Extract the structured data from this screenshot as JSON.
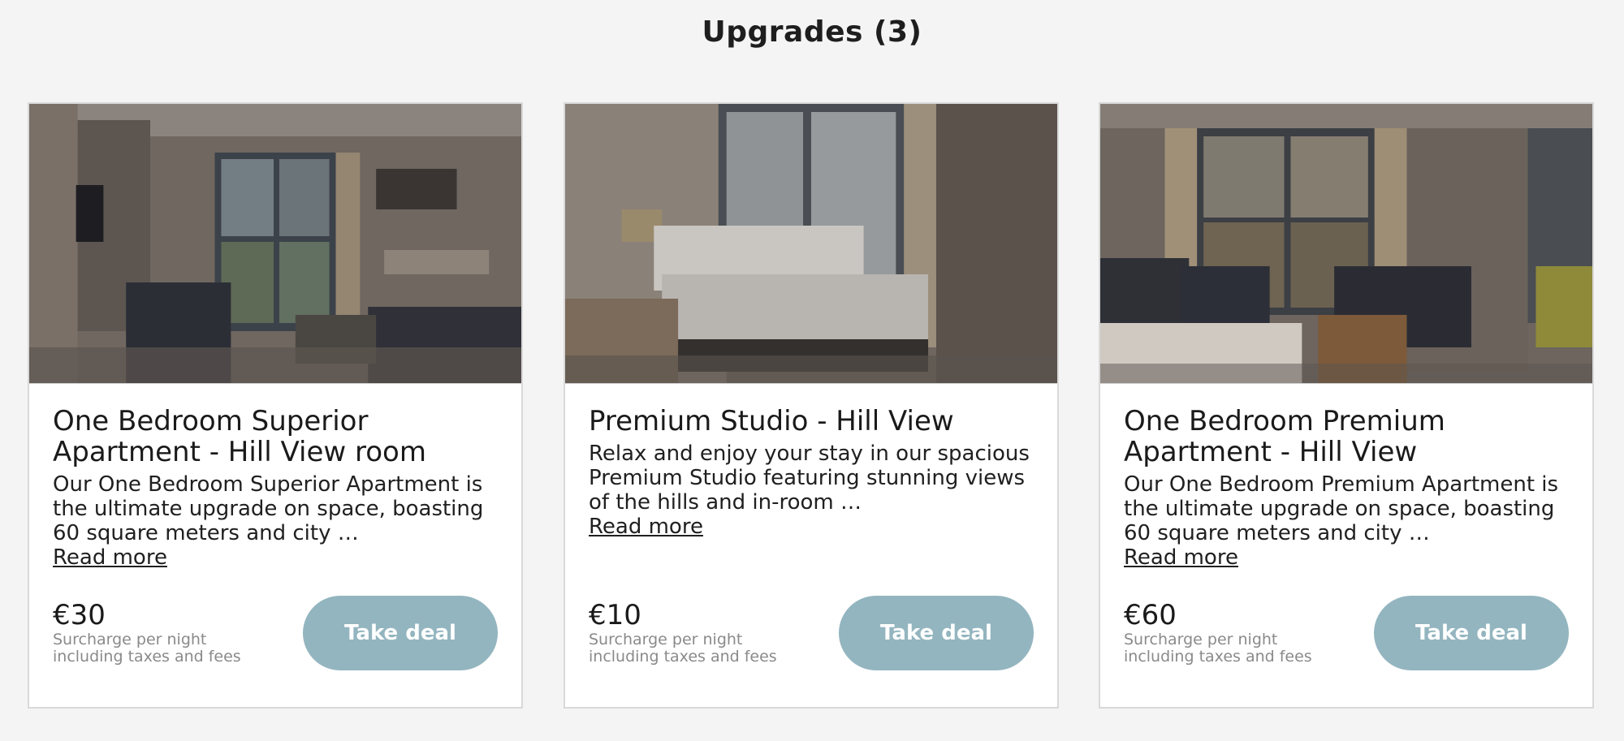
{
  "page": {
    "title": "Upgrades (3)"
  },
  "colors": {
    "background": "#f4f4f4",
    "card": "#ffffff",
    "button": "#93b5bf",
    "button_text": "#ffffff",
    "muted_text": "#8a8a8a"
  },
  "cards": [
    {
      "image": "hotel-room-photo-living-kitchen",
      "title": "One Bedroom Superior Apartment - Hill View room",
      "description": "Our One Bedroom Superior Apartment is the ultimate upgrade on space, boasting 60 square meters and city …",
      "read_more": "Read more",
      "price": "€30",
      "price_note": "Surcharge per night including taxes and fees",
      "button": "Take deal"
    },
    {
      "image": "hotel-room-photo-bedroom",
      "title": "Premium Studio - Hill View",
      "description": "Relax and enjoy your stay in our spacious Premium Studio featuring stunning views of the hills and in-room …",
      "read_more": "Read more",
      "price": "€10",
      "price_note": "Surcharge per night including taxes and fees",
      "button": "Take deal"
    },
    {
      "image": "hotel-room-photo-lounge",
      "title": "One Bedroom Premium Apartment - Hill View",
      "description": "Our One Bedroom Premium Apartment is the ultimate upgrade on space, boasting 60 square meters and city …",
      "read_more": "Read more",
      "price": "€60",
      "price_note": "Surcharge per night including taxes and fees",
      "button": "Take deal"
    }
  ]
}
